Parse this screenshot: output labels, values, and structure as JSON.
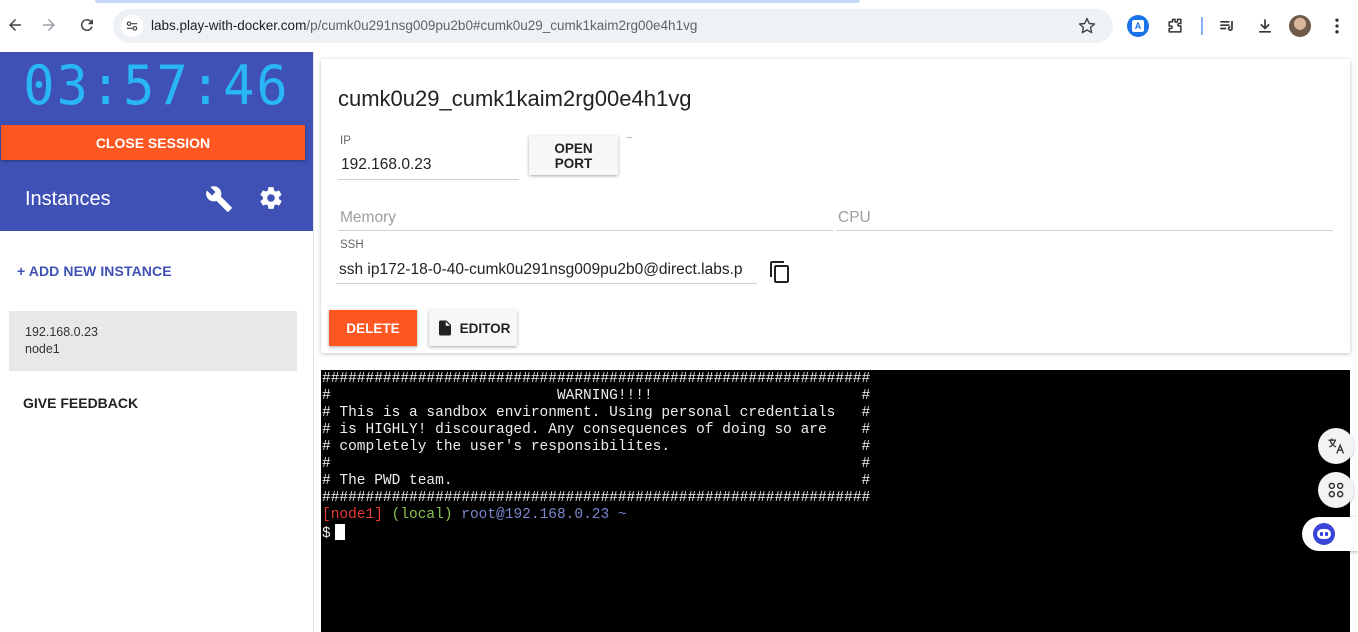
{
  "browser": {
    "url_host": "labs.play-with-docker.com",
    "url_path": "/p/cumk0u291nsg009pu2b0#cumk0u29_cumk1kaim2rg00e4h1vg",
    "icons": [
      "back-icon",
      "forward-icon",
      "reload-icon",
      "site-info-icon",
      "bookmark-star-icon",
      "translate-icon",
      "extensions-icon",
      "media-icon",
      "downloads-icon",
      "profile-avatar",
      "menu-icon"
    ]
  },
  "sidebar": {
    "timer": "03:57:46",
    "close_session_label": "CLOSE SESSION",
    "instances_title": "Instances",
    "add_instance_label": "+ ADD NEW INSTANCE",
    "instances": [
      {
        "ip": "192.168.0.23",
        "name": "node1"
      }
    ],
    "feedback_label": "GIVE FEEDBACK"
  },
  "instance": {
    "title": "cumk0u29_cumk1kaim2rg00e4h1vg",
    "ip_label": "IP",
    "ip_value": "192.168.0.23",
    "open_port_label": "OPEN PORT",
    "memory_placeholder": "Memory",
    "cpu_placeholder": "CPU",
    "ssh_label": "SSH",
    "ssh_value": "ssh ip172-18-0-40-cumk0u291nsg009pu2b0@direct.labs.p",
    "delete_label": "DELETE",
    "editor_label": "EDITOR"
  },
  "terminal": {
    "banner_lines": [
      "###############################################################",
      "#                          WARNING!!!!                        #",
      "# This is a sandbox environment. Using personal credentials   #",
      "# is HIGHLY! discouraged. Any consequences of doing so are    #",
      "# completely the user's responsibilites.                      #",
      "#                                                             #",
      "# The PWD team.                                               #",
      "###############################################################"
    ],
    "prompt_node": "[node1]",
    "prompt_local": "(local)",
    "prompt_user": "root@192.168.0.23 ~",
    "prompt_symbol": "$"
  },
  "colors": {
    "primary": "#3f51b5",
    "accent": "#ff5722",
    "timer": "#29b6f6"
  }
}
